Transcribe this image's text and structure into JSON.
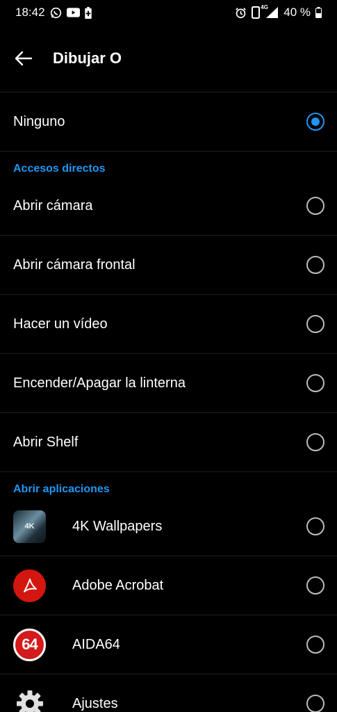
{
  "status_bar": {
    "time": "18:42",
    "battery_percent": "40 %",
    "network_label": "4G",
    "icons": [
      "whatsapp-icon",
      "youtube-icon",
      "battery-saver-icon",
      "alarm-icon",
      "vibrate-icon",
      "signal-icon",
      "battery-icon"
    ]
  },
  "app_bar": {
    "title": "Dibujar O",
    "back_icon": "arrow-left-icon"
  },
  "options": {
    "none_label": "Ninguno",
    "none_selected": true
  },
  "sections": {
    "shortcuts_header": "Accesos directos",
    "apps_header": "Abrir aplicaciones"
  },
  "shortcuts": [
    {
      "label": "Abrir cámara",
      "selected": false
    },
    {
      "label": "Abrir cámara frontal",
      "selected": false
    },
    {
      "label": "Hacer un vídeo",
      "selected": false
    },
    {
      "label": "Encender/Apagar la linterna",
      "selected": false
    },
    {
      "label": "Abrir Shelf",
      "selected": false
    }
  ],
  "apps": [
    {
      "label": "4K Wallpapers",
      "icon": "4k-wallpapers-icon",
      "icon_text": "4K",
      "selected": false
    },
    {
      "label": "Adobe Acrobat",
      "icon": "adobe-acrobat-icon",
      "selected": false
    },
    {
      "label": "AIDA64",
      "icon": "aida64-icon",
      "icon_text": "64",
      "selected": false
    },
    {
      "label": "Ajustes",
      "icon": "gear-icon",
      "selected": false
    }
  ],
  "colors": {
    "accent": "#2196f3",
    "background": "#000000",
    "divider": "#1f1f1f",
    "radio_off": "#bdbdbd"
  }
}
